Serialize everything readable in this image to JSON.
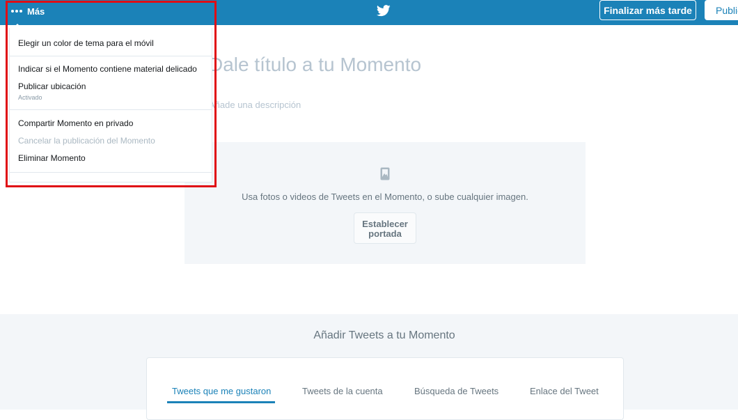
{
  "topbar": {
    "more_label": "Más",
    "finish_later_label": "Finalizar más tarde",
    "publish_label": "Publicar"
  },
  "menu": {
    "items": [
      "Elegir un color de tema para el móvil",
      "Indicar si el Momento contiene material delicado",
      "Publicar ubicación",
      "Compartir Momento en privado",
      "Cancelar la publicación del Momento",
      "Eliminar Momento"
    ],
    "location_status": "Activado"
  },
  "editor": {
    "title_placeholder": "Dale título a tu Momento",
    "description_placeholder": "Añade una descripción",
    "cover_text": "Usa fotos o videos de Tweets en el Momento, o sube cualquier imagen.",
    "cover_button": "Establecer portada"
  },
  "add_tweets": {
    "title": "Añadir Tweets a tu Momento",
    "tabs": [
      "Tweets que me gustaron",
      "Tweets de la cuenta",
      "Búsqueda de Tweets",
      "Enlace del Tweet"
    ]
  },
  "colors": {
    "brand": "#1b82b8",
    "highlight": "#e00d15"
  }
}
